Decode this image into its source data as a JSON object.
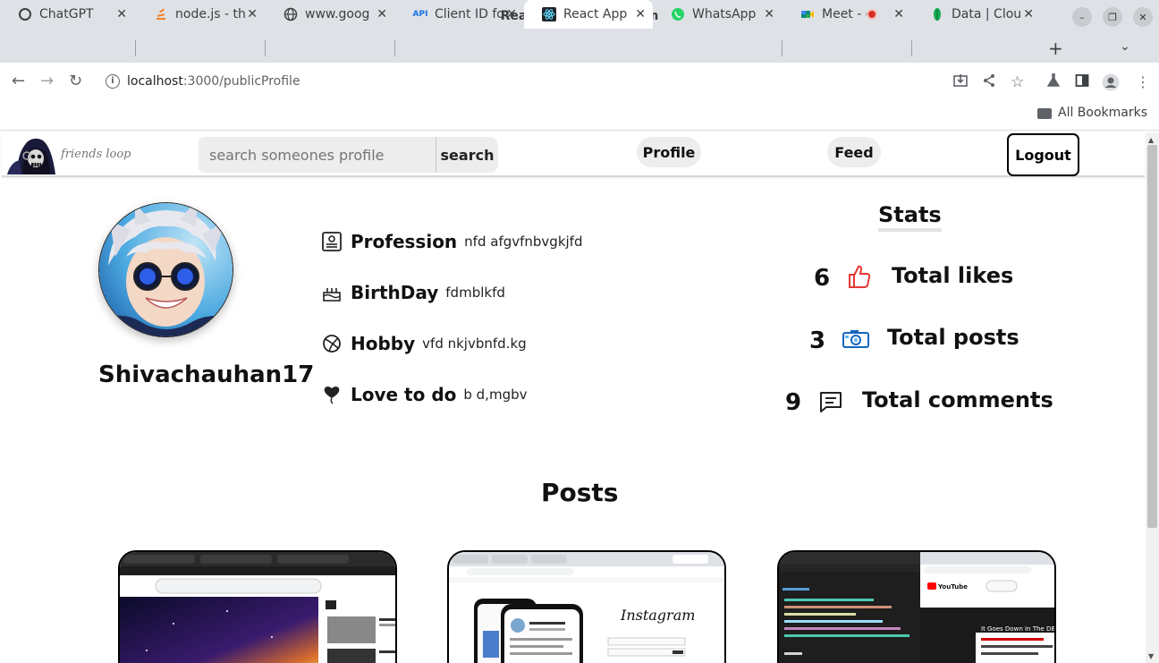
{
  "window": {
    "title": "React App - Chromium"
  },
  "tabs": [
    {
      "label": "ChatGPT"
    },
    {
      "label": "node.js - th"
    },
    {
      "label": "www.goog"
    },
    {
      "label": "Client ID fo"
    },
    {
      "label": "React App"
    },
    {
      "label": "WhatsApp"
    },
    {
      "label": "Meet - o"
    },
    {
      "label": "Data | Clou"
    }
  ],
  "address": {
    "host": "localhost",
    "port_path": ":3000/publicProfile"
  },
  "bookmarks": {
    "all_label": "All Bookmarks"
  },
  "app": {
    "logo_text": "friends loop",
    "search_placeholder": "search someones profile",
    "search_label": "search",
    "profile_label": "Profile",
    "feed_label": "Feed",
    "logout_label": "Logout"
  },
  "profile": {
    "username": "Shivachauhan17",
    "fields": [
      {
        "key": "Profession",
        "value": "nfd afgvfnbvgkjfd"
      },
      {
        "key": "BirthDay",
        "value": "fdmblkfd"
      },
      {
        "key": "Hobby",
        "value": "vfd nkjvbnfd.kg"
      },
      {
        "key": "Love to do",
        "value": "b d,mgbv"
      }
    ]
  },
  "stats": {
    "title": "Stats",
    "items": [
      {
        "count": "6",
        "label": "Total likes"
      },
      {
        "count": "3",
        "label": "Total posts"
      },
      {
        "count": "9",
        "label": "Total comments"
      }
    ]
  },
  "posts": {
    "title": "Posts",
    "post2_title": "Instagram",
    "post3_text": "It Goes Down In The DB"
  },
  "colors": {
    "like_icon": "#e53935",
    "camera_icon": "#1565c0",
    "accent_blue": "#1a73e8"
  }
}
